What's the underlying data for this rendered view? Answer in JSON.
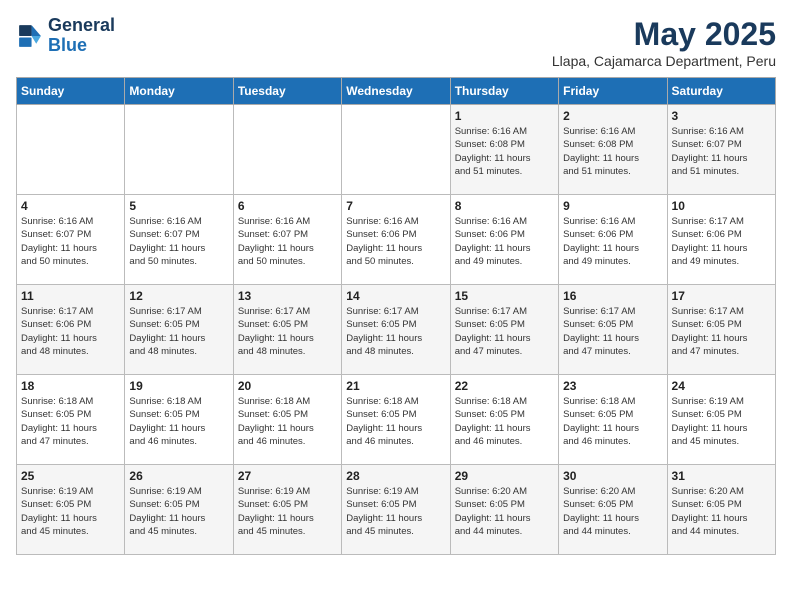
{
  "header": {
    "logo_line1": "General",
    "logo_line2": "Blue",
    "month_title": "May 2025",
    "subtitle": "Llapa, Cajamarca Department, Peru"
  },
  "days_of_week": [
    "Sunday",
    "Monday",
    "Tuesday",
    "Wednesday",
    "Thursday",
    "Friday",
    "Saturday"
  ],
  "weeks": [
    [
      {
        "day": "",
        "info": ""
      },
      {
        "day": "",
        "info": ""
      },
      {
        "day": "",
        "info": ""
      },
      {
        "day": "",
        "info": ""
      },
      {
        "day": "1",
        "info": "Sunrise: 6:16 AM\nSunset: 6:08 PM\nDaylight: 11 hours\nand 51 minutes."
      },
      {
        "day": "2",
        "info": "Sunrise: 6:16 AM\nSunset: 6:08 PM\nDaylight: 11 hours\nand 51 minutes."
      },
      {
        "day": "3",
        "info": "Sunrise: 6:16 AM\nSunset: 6:07 PM\nDaylight: 11 hours\nand 51 minutes."
      }
    ],
    [
      {
        "day": "4",
        "info": "Sunrise: 6:16 AM\nSunset: 6:07 PM\nDaylight: 11 hours\nand 50 minutes."
      },
      {
        "day": "5",
        "info": "Sunrise: 6:16 AM\nSunset: 6:07 PM\nDaylight: 11 hours\nand 50 minutes."
      },
      {
        "day": "6",
        "info": "Sunrise: 6:16 AM\nSunset: 6:07 PM\nDaylight: 11 hours\nand 50 minutes."
      },
      {
        "day": "7",
        "info": "Sunrise: 6:16 AM\nSunset: 6:06 PM\nDaylight: 11 hours\nand 50 minutes."
      },
      {
        "day": "8",
        "info": "Sunrise: 6:16 AM\nSunset: 6:06 PM\nDaylight: 11 hours\nand 49 minutes."
      },
      {
        "day": "9",
        "info": "Sunrise: 6:16 AM\nSunset: 6:06 PM\nDaylight: 11 hours\nand 49 minutes."
      },
      {
        "day": "10",
        "info": "Sunrise: 6:17 AM\nSunset: 6:06 PM\nDaylight: 11 hours\nand 49 minutes."
      }
    ],
    [
      {
        "day": "11",
        "info": "Sunrise: 6:17 AM\nSunset: 6:06 PM\nDaylight: 11 hours\nand 48 minutes."
      },
      {
        "day": "12",
        "info": "Sunrise: 6:17 AM\nSunset: 6:05 PM\nDaylight: 11 hours\nand 48 minutes."
      },
      {
        "day": "13",
        "info": "Sunrise: 6:17 AM\nSunset: 6:05 PM\nDaylight: 11 hours\nand 48 minutes."
      },
      {
        "day": "14",
        "info": "Sunrise: 6:17 AM\nSunset: 6:05 PM\nDaylight: 11 hours\nand 48 minutes."
      },
      {
        "day": "15",
        "info": "Sunrise: 6:17 AM\nSunset: 6:05 PM\nDaylight: 11 hours\nand 47 minutes."
      },
      {
        "day": "16",
        "info": "Sunrise: 6:17 AM\nSunset: 6:05 PM\nDaylight: 11 hours\nand 47 minutes."
      },
      {
        "day": "17",
        "info": "Sunrise: 6:17 AM\nSunset: 6:05 PM\nDaylight: 11 hours\nand 47 minutes."
      }
    ],
    [
      {
        "day": "18",
        "info": "Sunrise: 6:18 AM\nSunset: 6:05 PM\nDaylight: 11 hours\nand 47 minutes."
      },
      {
        "day": "19",
        "info": "Sunrise: 6:18 AM\nSunset: 6:05 PM\nDaylight: 11 hours\nand 46 minutes."
      },
      {
        "day": "20",
        "info": "Sunrise: 6:18 AM\nSunset: 6:05 PM\nDaylight: 11 hours\nand 46 minutes."
      },
      {
        "day": "21",
        "info": "Sunrise: 6:18 AM\nSunset: 6:05 PM\nDaylight: 11 hours\nand 46 minutes."
      },
      {
        "day": "22",
        "info": "Sunrise: 6:18 AM\nSunset: 6:05 PM\nDaylight: 11 hours\nand 46 minutes."
      },
      {
        "day": "23",
        "info": "Sunrise: 6:18 AM\nSunset: 6:05 PM\nDaylight: 11 hours\nand 46 minutes."
      },
      {
        "day": "24",
        "info": "Sunrise: 6:19 AM\nSunset: 6:05 PM\nDaylight: 11 hours\nand 45 minutes."
      }
    ],
    [
      {
        "day": "25",
        "info": "Sunrise: 6:19 AM\nSunset: 6:05 PM\nDaylight: 11 hours\nand 45 minutes."
      },
      {
        "day": "26",
        "info": "Sunrise: 6:19 AM\nSunset: 6:05 PM\nDaylight: 11 hours\nand 45 minutes."
      },
      {
        "day": "27",
        "info": "Sunrise: 6:19 AM\nSunset: 6:05 PM\nDaylight: 11 hours\nand 45 minutes."
      },
      {
        "day": "28",
        "info": "Sunrise: 6:19 AM\nSunset: 6:05 PM\nDaylight: 11 hours\nand 45 minutes."
      },
      {
        "day": "29",
        "info": "Sunrise: 6:20 AM\nSunset: 6:05 PM\nDaylight: 11 hours\nand 44 minutes."
      },
      {
        "day": "30",
        "info": "Sunrise: 6:20 AM\nSunset: 6:05 PM\nDaylight: 11 hours\nand 44 minutes."
      },
      {
        "day": "31",
        "info": "Sunrise: 6:20 AM\nSunset: 6:05 PM\nDaylight: 11 hours\nand 44 minutes."
      }
    ]
  ]
}
